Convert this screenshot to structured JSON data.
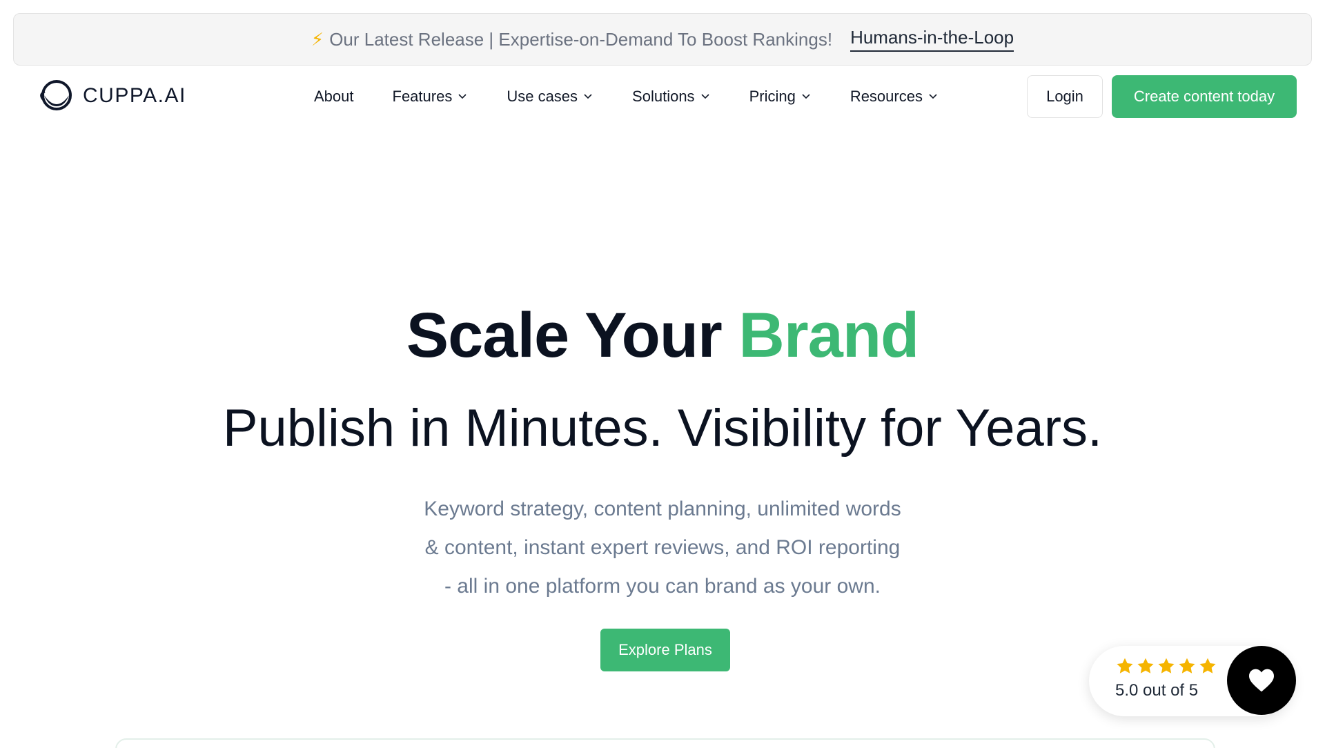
{
  "announcement": {
    "bolt_icon": "lightning-icon",
    "text": "Our Latest Release | Expertise-on-Demand To Boost Rankings!",
    "link_label": "Humans-in-the-Loop"
  },
  "nav": {
    "logo_text": "CUPPA.AI",
    "items": [
      {
        "label": "About",
        "has_dropdown": false
      },
      {
        "label": "Features",
        "has_dropdown": true
      },
      {
        "label": "Use cases",
        "has_dropdown": true
      },
      {
        "label": "Solutions",
        "has_dropdown": true
      },
      {
        "label": "Pricing",
        "has_dropdown": true
      },
      {
        "label": "Resources",
        "has_dropdown": true
      }
    ],
    "login_label": "Login",
    "cta_label": "Create content today"
  },
  "hero": {
    "title_part1": "Scale Your",
    "title_accent": "Brand",
    "subtitle": "Publish in Minutes. Visibility for Years.",
    "lead_lines": [
      "Keyword strategy, content planning, unlimited words",
      "& content, instant expert reviews, and ROI reporting",
      "- all in one platform you can brand as your own."
    ],
    "cta_label": "Explore Plans"
  },
  "rating": {
    "stars": 5,
    "text": "5.0 out of 5",
    "heart_icon": "heart-icon"
  },
  "colors": {
    "accent": "#3db874",
    "star": "#f5b400",
    "text_dark": "#0b1220",
    "text_muted": "#6b7a90"
  }
}
